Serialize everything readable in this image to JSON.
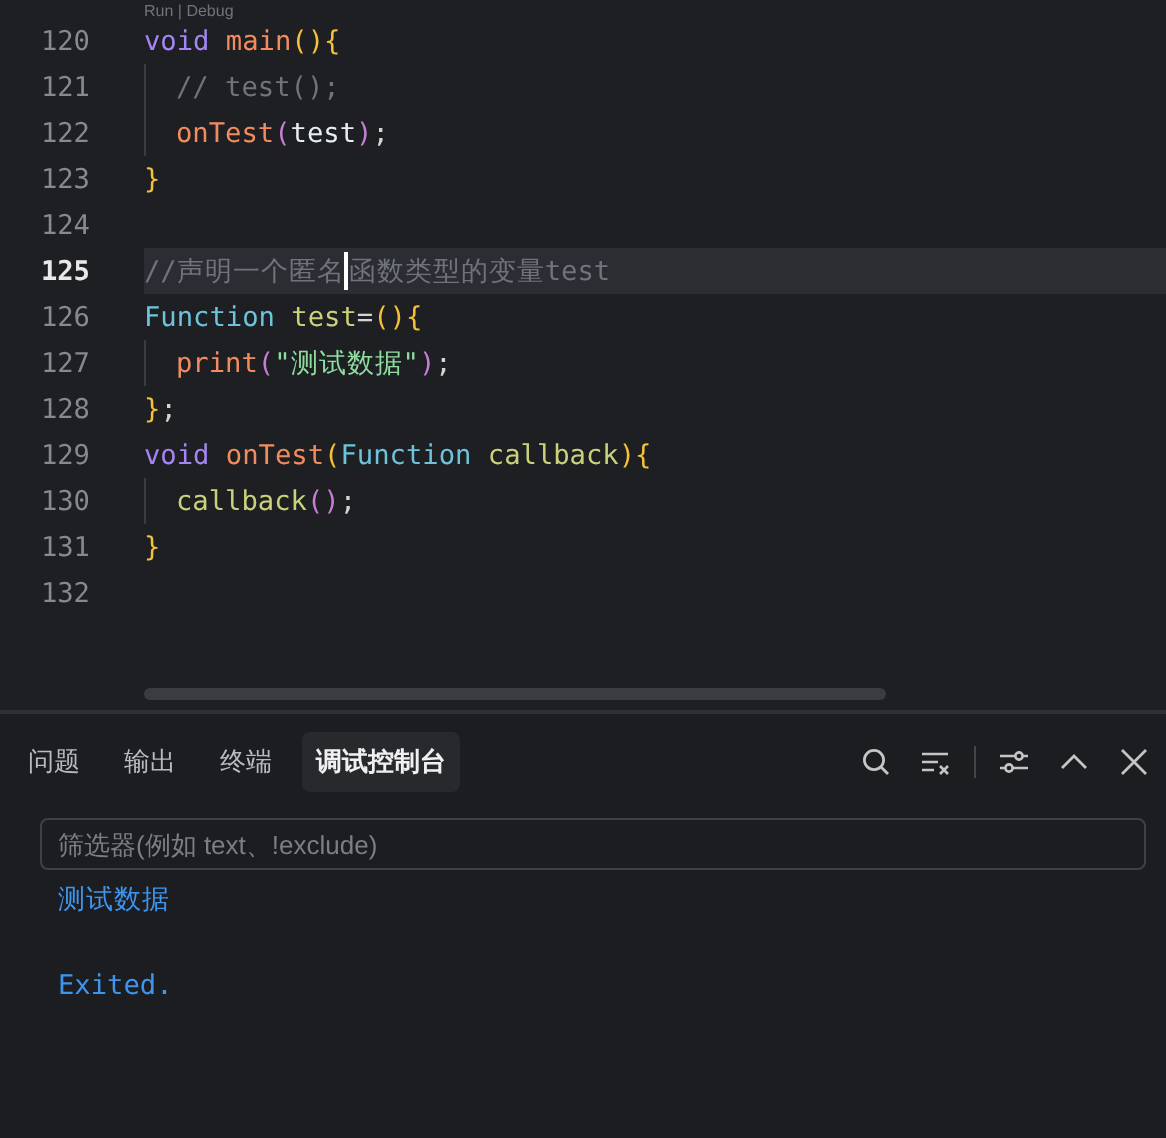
{
  "code_lens": "Run | Debug",
  "editor": {
    "lines": [
      {
        "number": "120",
        "active": false,
        "indent": false,
        "tokens": [
          {
            "kind": "keyword",
            "text": "void "
          },
          {
            "kind": "func",
            "text": "main"
          },
          {
            "kind": "bracket",
            "text": "(){"
          }
        ]
      },
      {
        "number": "121",
        "active": false,
        "indent": true,
        "tokens": [
          {
            "kind": "comment",
            "text": "// test();"
          }
        ]
      },
      {
        "number": "122",
        "active": false,
        "indent": true,
        "tokens": [
          {
            "kind": "func",
            "text": "onTest"
          },
          {
            "kind": "paren",
            "text": "("
          },
          {
            "kind": "var",
            "text": "test"
          },
          {
            "kind": "paren",
            "text": ")"
          },
          {
            "kind": "plain",
            "text": ";"
          }
        ]
      },
      {
        "number": "123",
        "active": false,
        "indent": false,
        "tokens": [
          {
            "kind": "bracket",
            "text": "}"
          }
        ]
      },
      {
        "number": "124",
        "active": false,
        "indent": false
      },
      {
        "number": "125",
        "active": true,
        "indent": false,
        "tokens": [
          {
            "kind": "comment",
            "text": "//声明一个匿名"
          },
          {
            "kind": "cursor"
          },
          {
            "kind": "comment",
            "text": "函数类型的变量test"
          }
        ]
      },
      {
        "number": "126",
        "active": false,
        "indent": false,
        "tokens": [
          {
            "kind": "type",
            "text": "Function "
          },
          {
            "kind": "param",
            "text": "test"
          },
          {
            "kind": "plain",
            "text": "="
          },
          {
            "kind": "bracket",
            "text": "(){"
          }
        ]
      },
      {
        "number": "127",
        "active": false,
        "indent": true,
        "tokens": [
          {
            "kind": "func",
            "text": "print"
          },
          {
            "kind": "paren",
            "text": "("
          },
          {
            "kind": "string",
            "text": "\"测试数据\""
          },
          {
            "kind": "paren",
            "text": ")"
          },
          {
            "kind": "plain",
            "text": ";"
          }
        ]
      },
      {
        "number": "128",
        "active": false,
        "indent": false,
        "tokens": [
          {
            "kind": "bracket",
            "text": "}"
          },
          {
            "kind": "plain",
            "text": ";"
          }
        ]
      },
      {
        "number": "129",
        "active": false,
        "indent": false,
        "tokens": [
          {
            "kind": "keyword",
            "text": "void "
          },
          {
            "kind": "func",
            "text": "onTest"
          },
          {
            "kind": "bracket",
            "text": "("
          },
          {
            "kind": "type",
            "text": "Function "
          },
          {
            "kind": "param",
            "text": "callback"
          },
          {
            "kind": "bracket",
            "text": "){"
          }
        ]
      },
      {
        "number": "130",
        "active": false,
        "indent": true,
        "tokens": [
          {
            "kind": "param",
            "text": "callback"
          },
          {
            "kind": "paren",
            "text": "()"
          },
          {
            "kind": "plain",
            "text": ";"
          }
        ]
      },
      {
        "number": "131",
        "active": false,
        "indent": false,
        "tokens": [
          {
            "kind": "bracket",
            "text": "}"
          }
        ]
      },
      {
        "number": "132",
        "active": false,
        "indent": false
      }
    ]
  },
  "panel": {
    "tabs": [
      {
        "label": "问题",
        "selected": false
      },
      {
        "label": "输出",
        "selected": false
      },
      {
        "label": "终端",
        "selected": false
      },
      {
        "label": "调试控制台",
        "selected": true
      }
    ],
    "filter": {
      "placeholder": "筛选器(例如 text、!exclude)"
    },
    "output": [
      {
        "text": "测试数据"
      },
      {
        "text": "Exited."
      }
    ]
  }
}
